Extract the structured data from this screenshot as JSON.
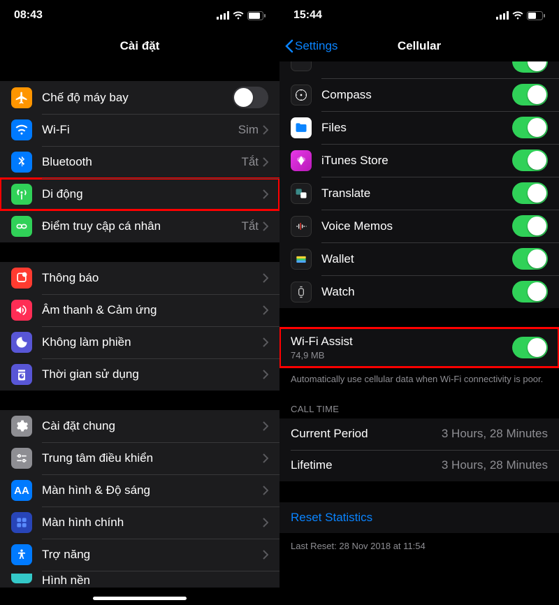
{
  "left": {
    "time": "08:43",
    "title": "Cài đặt",
    "rows": {
      "airplane": {
        "label": "Chế độ máy bay",
        "iconBg": "#ff9500"
      },
      "wifi": {
        "label": "Wi-Fi",
        "value": "Sim‎",
        "iconBg": "#007aff"
      },
      "bluetooth": {
        "label": "Bluetooth",
        "value": "Tắt",
        "iconBg": "#007aff"
      },
      "cellular": {
        "label": "Di động",
        "iconBg": "#30d158"
      },
      "hotspot": {
        "label": "Điểm truy cập cá nhân",
        "value": "Tắt",
        "iconBg": "#30d158"
      },
      "notify": {
        "label": "Thông báo",
        "iconBg": "#ff3b30"
      },
      "sound": {
        "label": "Âm thanh & Cảm ứng",
        "iconBg": "#ff2d55"
      },
      "dnd": {
        "label": "Không làm phiền",
        "iconBg": "#5856d6"
      },
      "screentime": {
        "label": "Thời gian sử dụng",
        "iconBg": "#5856d6"
      },
      "general": {
        "label": "Cài đặt chung",
        "iconBg": "#8e8e93"
      },
      "control": {
        "label": "Trung tâm điều khiển",
        "iconBg": "#8e8e93"
      },
      "display": {
        "label": "Màn hình & Độ sáng",
        "iconBg": "#007aff"
      },
      "home": {
        "label": "Màn hình chính",
        "iconBg": "#2845b8"
      },
      "access": {
        "label": "Trợ năng",
        "iconBg": "#007aff"
      },
      "wallpaper": {
        "label": "Hình nền"
      }
    }
  },
  "right": {
    "time": "15:44",
    "back": "Settings",
    "title": "Cellular",
    "apps": {
      "compass": {
        "label": "Compass",
        "iconBg": "#1c1c1e"
      },
      "files": {
        "label": "Files",
        "iconBg": "#0a84ff"
      },
      "itunes": {
        "label": "iTunes Store",
        "iconBg": "#c22dc2"
      },
      "translate": {
        "label": "Translate",
        "iconBg": "#1c1c1e"
      },
      "voice": {
        "label": "Voice Memos",
        "iconBg": "#1c1c1e"
      },
      "wallet": {
        "label": "Wallet",
        "iconBg": "#1c1c1e"
      },
      "watch": {
        "label": "Watch",
        "iconBg": "#1c1c1e"
      }
    },
    "wifiAssist": {
      "label": "Wi-Fi Assist",
      "sub": "74,9 MB"
    },
    "assistDesc": "Automatically use cellular data when Wi-Fi connectivity is poor.",
    "callHeader": "CALL TIME",
    "current": {
      "label": "Current Period",
      "value": "3 Hours, 28 Minutes"
    },
    "lifetime": {
      "label": "Lifetime",
      "value": "3 Hours, 28 Minutes"
    },
    "reset": "Reset Statistics",
    "lastReset": "Last Reset: 28 Nov 2018 at 11:54"
  }
}
